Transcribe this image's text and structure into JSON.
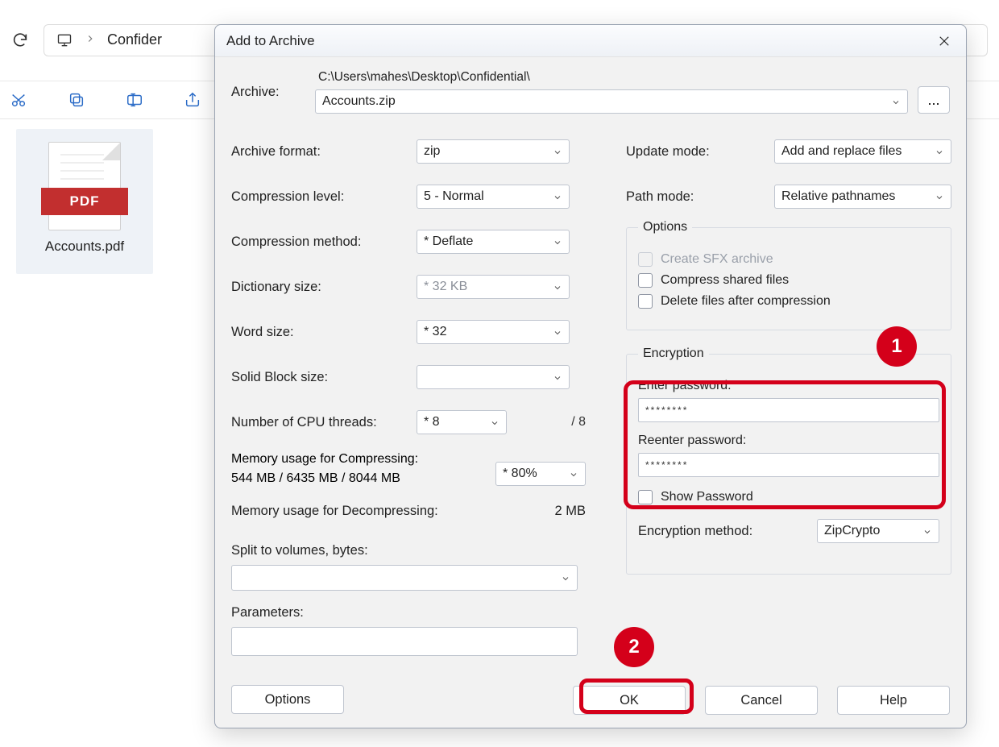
{
  "toolbar": {
    "breadcrumb_text": "Confider"
  },
  "file": {
    "pdf_band": "PDF",
    "caption": "Accounts.pdf"
  },
  "dialog": {
    "title": "Add to Archive",
    "archive_label": "Archive:",
    "archive_path": "C:\\Users\\mahes\\Desktop\\Confidential\\",
    "archive_name": "Accounts.zip",
    "browse_label": "...",
    "left": {
      "format_label": "Archive format:",
      "format_value": "zip",
      "level_label": "Compression level:",
      "level_value": "5 - Normal",
      "method_label": "Compression method:",
      "method_value": "*  Deflate",
      "dict_label": "Dictionary size:",
      "dict_value": "*  32 KB",
      "word_label": "Word size:",
      "word_value": "*  32",
      "solid_label": "Solid Block size:",
      "solid_value": "",
      "threads_label": "Number of CPU threads:",
      "threads_value": "*  8",
      "threads_total": "/ 8",
      "mem_comp_label": "Memory usage for Compressing:",
      "mem_comp_detail": "544 MB / 6435 MB / 8044 MB",
      "mem_pct_value": "* 80%",
      "mem_decomp_label": "Memory usage for Decompressing:",
      "mem_decomp_value": "2 MB",
      "split_label": "Split to volumes, bytes:",
      "params_label": "Parameters:",
      "options_btn": "Options"
    },
    "right": {
      "update_label": "Update mode:",
      "update_value": "Add and replace files",
      "path_label": "Path mode:",
      "path_value": "Relative pathnames",
      "options_legend": "Options",
      "sfx_label": "Create SFX archive",
      "shared_label": "Compress shared files",
      "delete_label": "Delete files after compression",
      "enc_legend": "Encryption",
      "pw1_label": "Enter password:",
      "pw1_value": "********",
      "pw2_label": "Reenter password:",
      "pw2_value": "********",
      "showpw_label": "Show Password",
      "encmethod_label": "Encryption method:",
      "encmethod_value": "ZipCrypto"
    },
    "buttons": {
      "ok": "OK",
      "cancel": "Cancel",
      "help": "Help"
    }
  },
  "annotations": {
    "badge1": "1",
    "badge2": "2"
  }
}
